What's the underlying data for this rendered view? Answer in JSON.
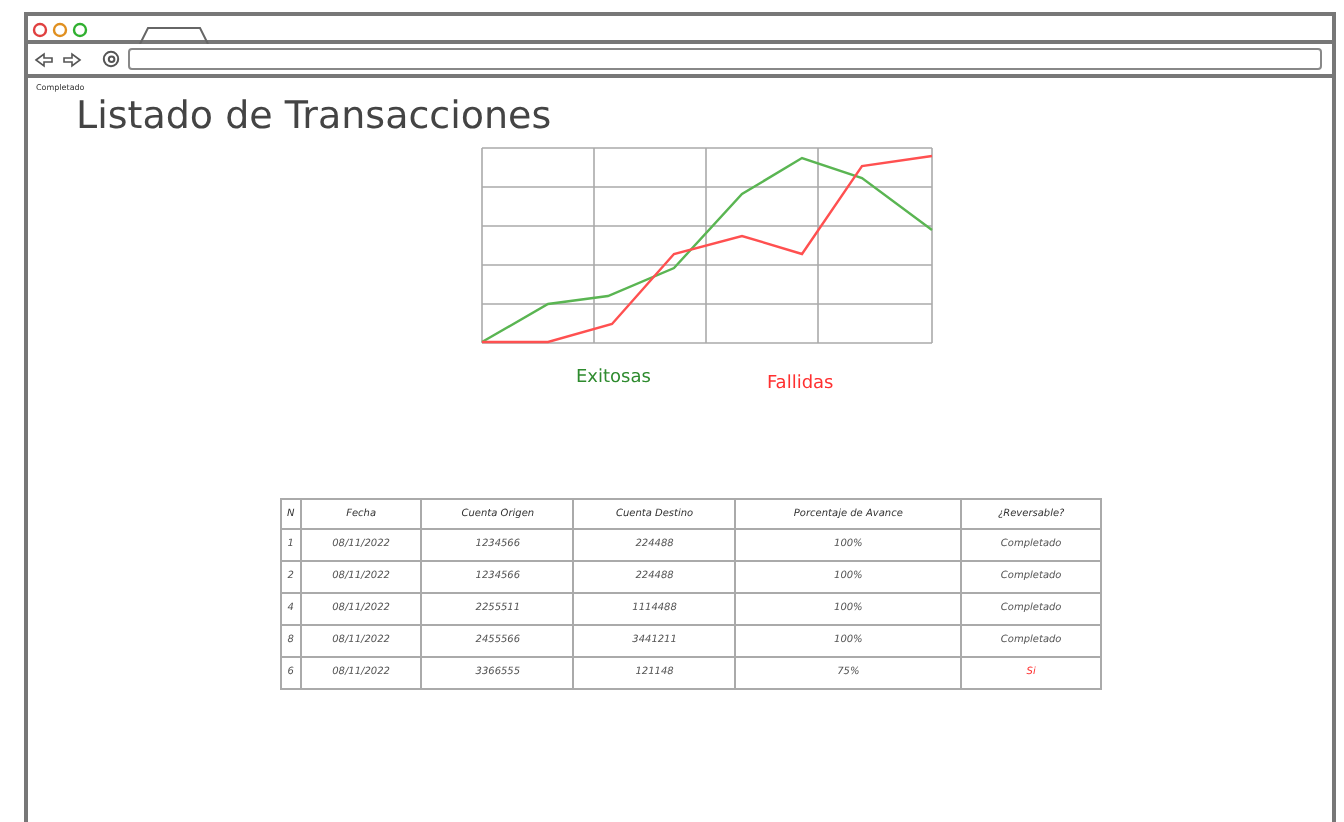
{
  "status_label": "Completado",
  "title": "Listado de Transacciones",
  "legend": [
    {
      "label": "Exitosas",
      "color": "#2e8b2e"
    },
    {
      "label": "Fallidas",
      "color": "#ff3030"
    }
  ],
  "table": {
    "columns": [
      "N",
      "Fecha",
      "Cuenta Origen",
      "Cuenta Destino",
      "Porcentaje de Avance",
      "¿Reversable?"
    ],
    "rows": [
      {
        "cells": [
          "1",
          "08/11/2022",
          "1234566",
          "224488",
          "100%"
        ],
        "status": {
          "text": "Completado",
          "flagged": false
        }
      },
      {
        "cells": [
          "2",
          "08/11/2022",
          "1234566",
          "224488",
          "100%"
        ],
        "status": {
          "text": "Completado",
          "flagged": false
        }
      },
      {
        "cells": [
          "4",
          "08/11/2022",
          "2255511",
          "1114488",
          "100%"
        ],
        "status": {
          "text": "Completado",
          "flagged": false
        }
      },
      {
        "cells": [
          "8",
          "08/11/2022",
          "2455566",
          "3441211",
          "100%"
        ],
        "status": {
          "text": "Completado",
          "flagged": false
        }
      },
      {
        "cells": [
          "6",
          "08/11/2022",
          "3366555",
          "121148",
          "75%"
        ],
        "status": {
          "text": "Si",
          "flagged": true
        }
      }
    ]
  }
}
